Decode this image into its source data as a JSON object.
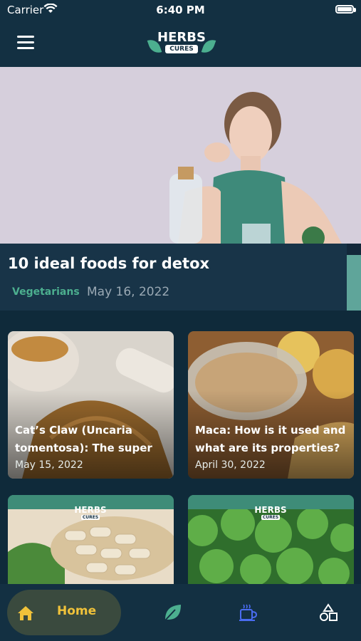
{
  "status_bar": {
    "carrier": "Carrier",
    "time": "6:40 PM"
  },
  "header": {
    "logo_main": "HERBS",
    "logo_sub": "CURES"
  },
  "hero": {
    "title": "10 ideal foods for detox",
    "category": "Vegetarians",
    "date": "May 16, 2022"
  },
  "articles": [
    {
      "title": "Cat’s Claw (Uncaria tomentosa): The super",
      "date": "May 15, 2022"
    },
    {
      "title": "Maca: How is it used and what are its properties?",
      "date": "April 30, 2022"
    }
  ],
  "placeholders": [
    {
      "logo_main": "HERBS",
      "logo_sub": "CURES"
    },
    {
      "logo_main": "HERBS",
      "logo_sub": "CURES"
    }
  ],
  "tabbar": {
    "home_label": "Home"
  },
  "colors": {
    "accent_green": "#4caf8f",
    "accent_yellow": "#f0c23a",
    "background": "#0f2a3a"
  }
}
